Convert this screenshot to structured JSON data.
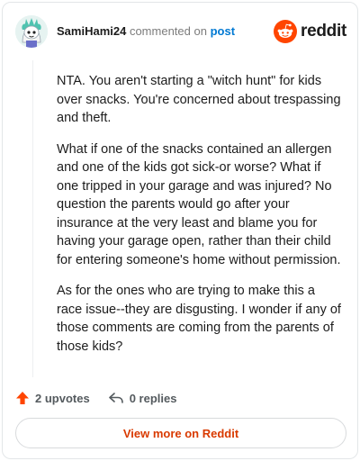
{
  "header": {
    "username": "SamiHami24",
    "action_text": "commented on",
    "post_link_text": "post",
    "brand_icon": "reddit-snoo-icon",
    "brand_wordmark": "reddit",
    "brand_color": "#ff4500"
  },
  "comment": {
    "paragraphs": [
      "NTA. You aren't starting a \"witch hunt\" for kids over snacks. You're concerned about trespassing and theft.",
      "What if one of the snacks contained an allergen and one of the kids got sick-or worse? What if one tripped in your garage and was injured? No question the parents would go after your insurance at the very least and blame you for having your garage open, rather than their child for entering someone's home without permission.",
      "As for the ones who are trying to make this a race issue--they are disgusting. I wonder if any of those comments are coming from the parents of those kids?"
    ]
  },
  "actions": {
    "upvotes_label": "2 upvotes",
    "upvote_icon": "upvote-arrow-icon",
    "upvote_color": "#ff4500",
    "replies_label": "0 replies",
    "reply_icon": "reply-arrow-icon"
  },
  "footer": {
    "view_more_label": "View more on Reddit",
    "view_more_color": "#d93a00"
  }
}
